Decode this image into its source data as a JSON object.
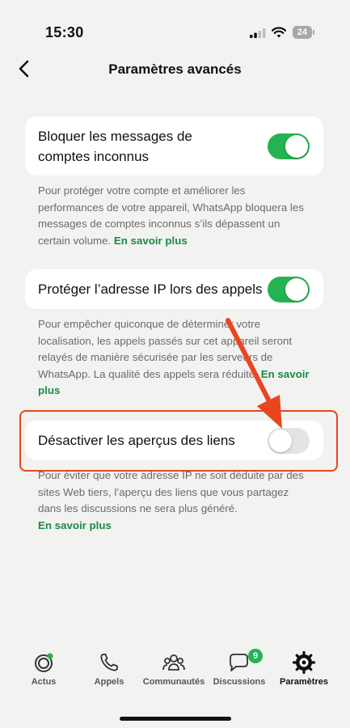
{
  "status_bar": {
    "time": "15:30",
    "battery": "24"
  },
  "nav": {
    "title": "Paramètres avancés"
  },
  "settings": [
    {
      "label_line1": "Bloquer les messages de",
      "label_line2": "comptes inconnus",
      "enabled": true,
      "description": "Pour protéger votre compte et améliorer les performances de votre appareil, WhatsApp bloquera les messages de comptes inconnus s’ils dépassent un certain volume.",
      "link": "En savoir plus"
    },
    {
      "label_line1": "Protéger l’adresse IP lors des appels",
      "enabled": true,
      "description": "Pour empêcher quiconque de déterminer votre localisation, les appels passés sur cet appareil seront relayés de manière sécurisée par les serveurs de WhatsApp. La qualité des appels sera réduite.",
      "link": "En savoir plus"
    },
    {
      "label_line1": "Désactiver les aperçus des liens",
      "enabled": false,
      "description": "Pour éviter que votre adresse IP ne soit déduite par des sites Web tiers, l’aperçu des liens que vous partagez dans les discussions ne sera plus généré.",
      "link": "En savoir plus"
    }
  ],
  "annotation": {
    "color": "#e8461f"
  },
  "tabs": [
    {
      "label": "Actus",
      "icon": "updates-icon"
    },
    {
      "label": "Appels",
      "icon": "phone-icon"
    },
    {
      "label": "Communautés",
      "icon": "communities-icon"
    },
    {
      "label": "Discussions",
      "icon": "chats-icon",
      "badge": "9"
    },
    {
      "label": "Paramètres",
      "icon": "settings-icon",
      "active": true
    }
  ],
  "colors": {
    "accent": "#25b351",
    "link": "#1a8a48",
    "background": "#f2f2f0"
  }
}
